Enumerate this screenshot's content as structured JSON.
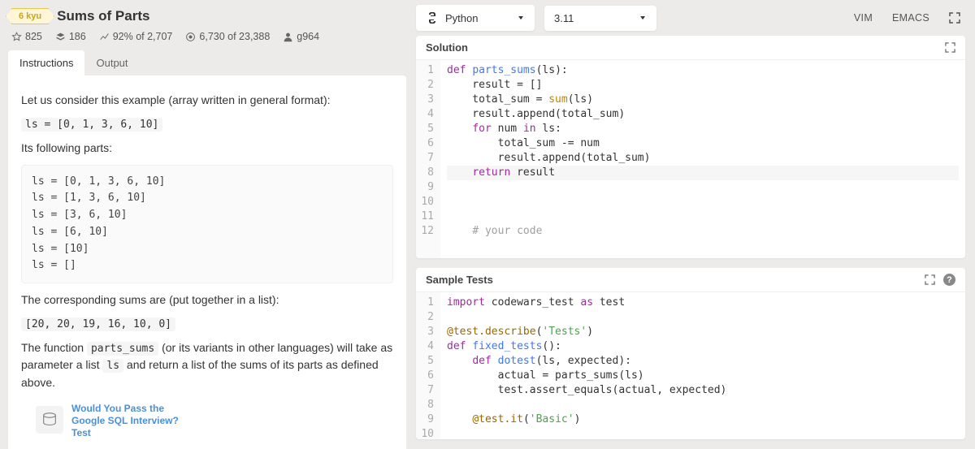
{
  "header": {
    "kyu": "6 kyu",
    "title": "Sums of Parts",
    "stats": {
      "stars": "825",
      "collections": "186",
      "satisfaction": "92% of 2,707",
      "completed": "6,730 of 23,388",
      "author": "g964"
    }
  },
  "tabs": {
    "instructions": "Instructions",
    "output": "Output"
  },
  "instructions": {
    "p1": "Let us consider this example (array written in general format):",
    "code1": "ls = [0, 1, 3, 6, 10]",
    "p2": "Its following parts:",
    "code2": "ls = [0, 1, 3, 6, 10]\nls = [1, 3, 6, 10]\nls = [3, 6, 10]\nls = [6, 10]\nls = [10]\nls = []",
    "p3": "The corresponding sums are (put together in a list):",
    "code3": "[20, 20, 19, 16, 10, 0]",
    "p4a": "The function ",
    "p4code1": "parts_sums",
    "p4b": " (or its variants in other languages) will take as parameter a list ",
    "p4code2": "ls",
    "p4c": " and return a list of the sums of its parts as defined above."
  },
  "ad": {
    "text": "Would You Pass the Google SQL Interview? Test"
  },
  "topbar": {
    "language": "Python",
    "version": "3.11",
    "vim": "VIM",
    "emacs": "EMACS"
  },
  "solution": {
    "title": "Solution",
    "lines": [
      {
        "html": "<span class='kw'>def</span> <span class='fn'>parts_sums</span>(ls):"
      },
      {
        "html": "    result = []"
      },
      {
        "html": "    total_sum = <span class='bi'>sum</span>(ls)"
      },
      {
        "html": "    result.append(total_sum)"
      },
      {
        "html": "    <span class='kw'>for</span> num <span class='kw'>in</span> ls:"
      },
      {
        "html": "        total_sum -= num"
      },
      {
        "html": "        result.append(total_sum)"
      },
      {
        "html": "    <span class='kw'>return</span> result",
        "cursor": true
      },
      {
        "html": ""
      },
      {
        "html": ""
      },
      {
        "html": ""
      },
      {
        "html": "    <span class='cm'># your code</span>"
      }
    ]
  },
  "tests": {
    "title": "Sample Tests",
    "lines": [
      {
        "html": "<span class='kw'>import</span> codewars_test <span class='kw'>as</span> test"
      },
      {
        "html": ""
      },
      {
        "html": "<span class='dec'>@test.describe</span>(<span class='st'>'Tests'</span>)"
      },
      {
        "html": "<span class='kw'>def</span> <span class='fn'>fixed_tests</span>():"
      },
      {
        "html": "    <span class='kw'>def</span> <span class='fn'>dotest</span>(ls, expected):"
      },
      {
        "html": "        actual = parts_sums(ls)"
      },
      {
        "html": "        test.assert_equals(actual, expected)"
      },
      {
        "html": ""
      },
      {
        "html": "    <span class='dec'>@test.it</span>(<span class='st'>'Basic'</span>)"
      },
      {
        "html": ""
      }
    ]
  }
}
